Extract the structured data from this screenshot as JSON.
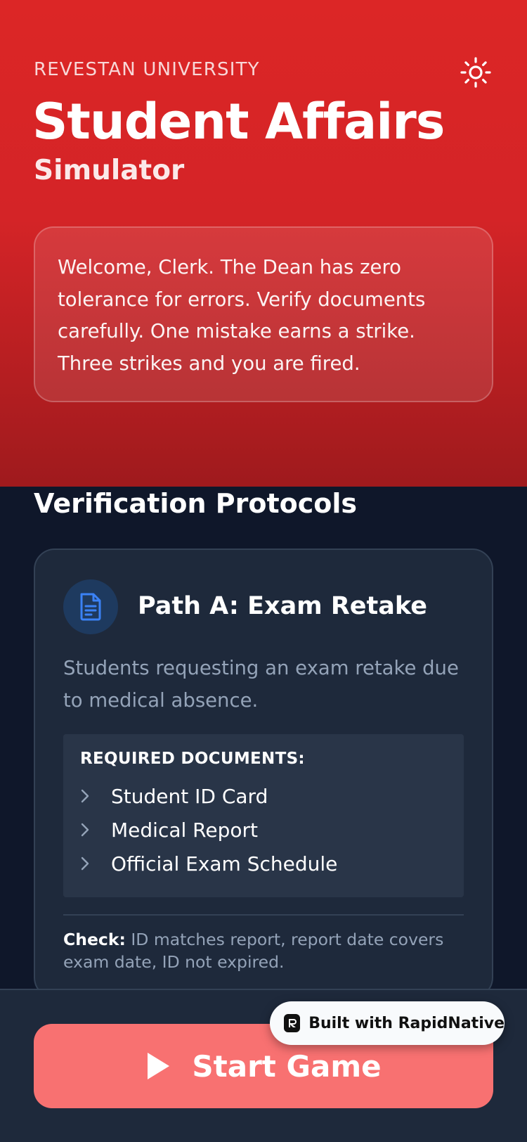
{
  "header": {
    "university": "REVESTAN UNIVERSITY",
    "title": "Student Affairs",
    "subtitle": "Simulator",
    "theme_icon": "sun-icon",
    "welcome_text": "Welcome, Clerk. The Dean has zero tolerance for errors. Verify documents carefully. One mistake earns a strike. Three strikes and you are fired."
  },
  "protocols": {
    "section_title": "Verification Protocols",
    "card": {
      "icon": "document-icon",
      "title": "Path A: Exam Retake",
      "description": "Students requesting an exam retake due to medical absence.",
      "required_heading": "REQUIRED DOCUMENTS:",
      "documents": [
        "Student ID Card",
        "Medical Report",
        "Official Exam Schedule"
      ],
      "check_label": "Check:",
      "check_text": "ID matches report, report date covers exam date, ID not expired."
    }
  },
  "footer": {
    "start_label": "Start Game",
    "start_icon": "play-icon",
    "badge_label": "Built with RapidNative"
  },
  "colors": {
    "hero_red": "#dc2626",
    "background": "#0f172a",
    "card": "#1e293b",
    "accent_blue": "#3b82f6",
    "start_button": "#f87171"
  }
}
